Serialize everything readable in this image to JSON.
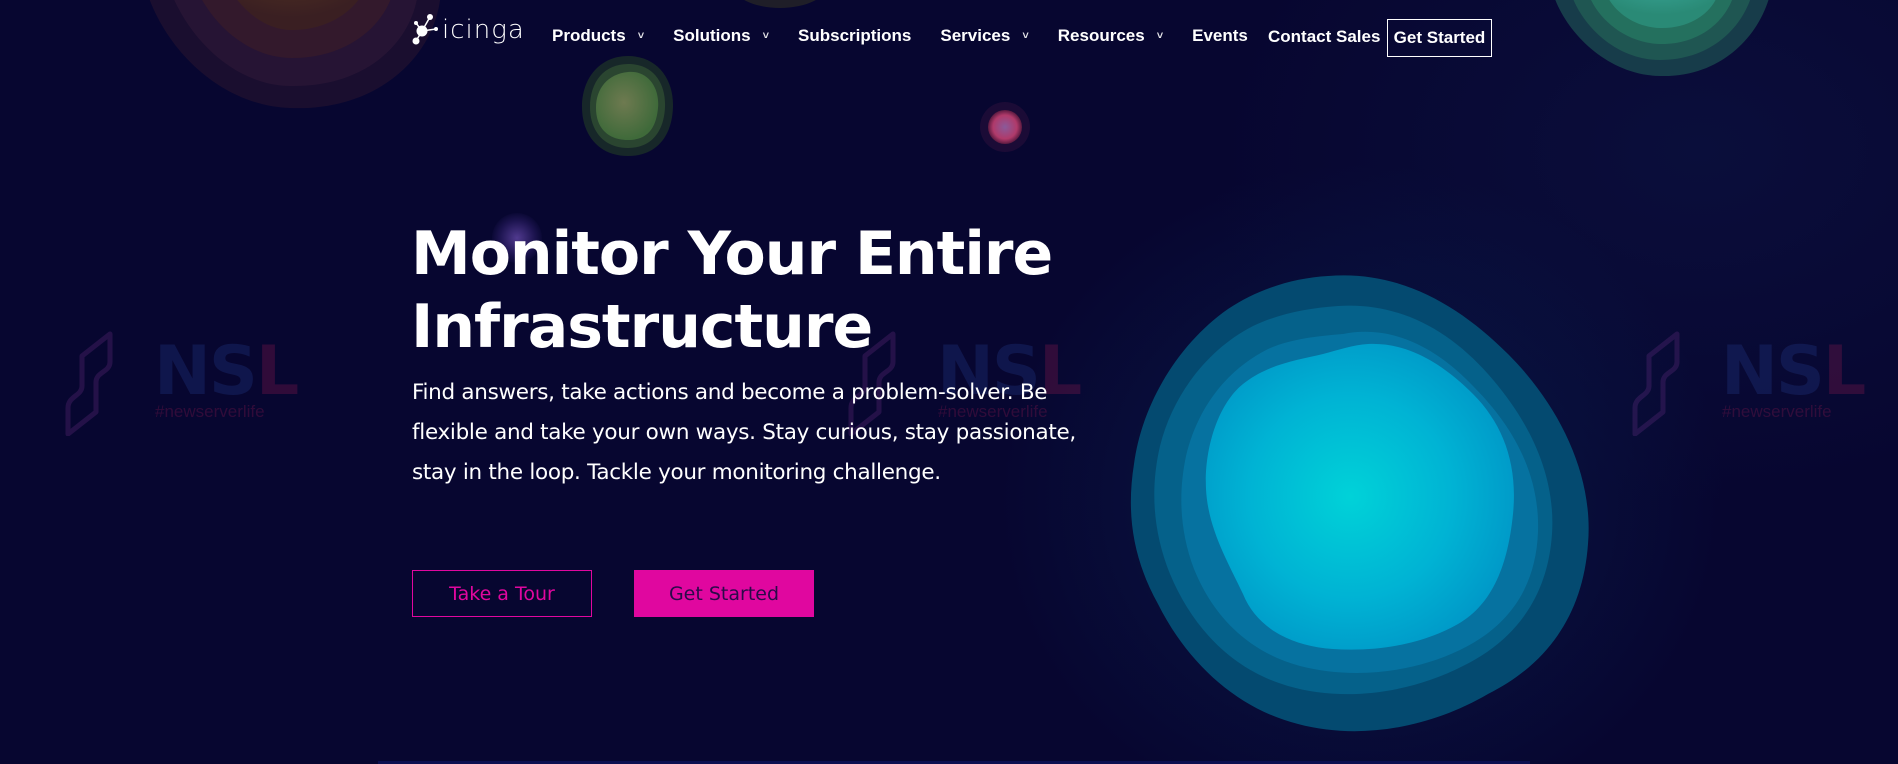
{
  "header": {
    "logo_text": "icinga",
    "nav": [
      {
        "label": "Products",
        "has_dropdown": true
      },
      {
        "label": "Solutions",
        "has_dropdown": true
      },
      {
        "label": "Subscriptions",
        "has_dropdown": false
      },
      {
        "label": "Services",
        "has_dropdown": true
      },
      {
        "label": "Resources",
        "has_dropdown": true
      },
      {
        "label": "Events",
        "has_dropdown": false
      }
    ],
    "contact_label": "Contact Sales",
    "cta_label": "Get Started",
    "chevron_glyph": "˅"
  },
  "hero": {
    "title_line1": "Monitor Your Entire",
    "title_line2": "Infrastructure",
    "lead_line1": "Find answers, take actions and become a problem-solver. Be",
    "lead_line2": "flexible and take your own ways. Stay curious, stay passionate,",
    "lead_line3": "stay in the loop. Tackle your monitoring challenge.",
    "tour_label": "Take a Tour",
    "start_label": "Get Started"
  },
  "watermark": {
    "brand": "NSL",
    "brand_first": "NS",
    "brand_last": "L",
    "tagline": "#newserverlife"
  },
  "colors": {
    "background": "#070630",
    "accent": "#e0079f",
    "text": "#ffffff"
  }
}
